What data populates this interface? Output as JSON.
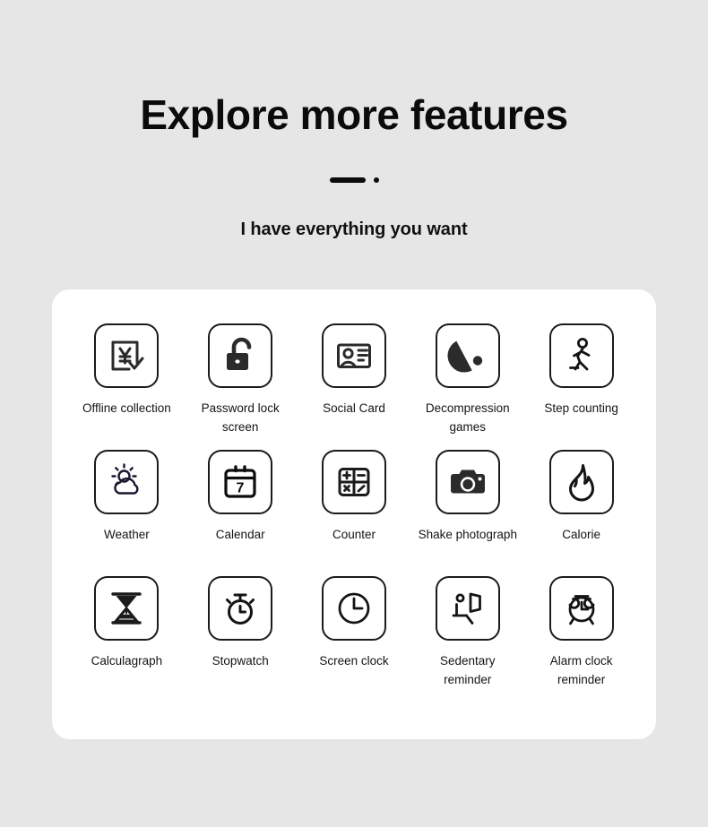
{
  "header": {
    "title": "Explore more features",
    "subtitle": "I have everything you want",
    "divider_dash": "horizontal-dash",
    "divider_dot": "dot"
  },
  "colors": {
    "page_background": "#e6e6e6",
    "card_background": "#ffffff",
    "icon_stroke": "#1b1b1b",
    "text": "#111111"
  },
  "features": {
    "rows": [
      [
        {
          "label": "Offline collection",
          "icon": "yen-document-check-icon"
        },
        {
          "label": "Password lock screen",
          "icon": "open-padlock-icon"
        },
        {
          "label": "Social Card",
          "icon": "id-card-icon"
        },
        {
          "label": "Decompression games",
          "icon": "pacman-icon"
        },
        {
          "label": "Step counting",
          "icon": "walking-person-icon"
        }
      ],
      [
        {
          "label": "Weather",
          "icon": "sun-cloud-icon"
        },
        {
          "label": "Calendar",
          "icon": "calendar-7-icon"
        },
        {
          "label": "Counter",
          "icon": "calculator-grid-icon"
        },
        {
          "label": "Shake photograph",
          "icon": "camera-icon"
        },
        {
          "label": "Calorie",
          "icon": "flame-icon"
        }
      ],
      [
        {
          "label": "Calculagraph",
          "icon": "hourglass-icon"
        },
        {
          "label": "Stopwatch",
          "icon": "stopwatch-icon"
        },
        {
          "label": "Screen clock",
          "icon": "clock-icon"
        },
        {
          "label": "Sedentary reminder",
          "icon": "sitting-person-desk-icon"
        },
        {
          "label": "Alarm clock reminder",
          "icon": "alarm-clock-icon"
        }
      ]
    ]
  }
}
